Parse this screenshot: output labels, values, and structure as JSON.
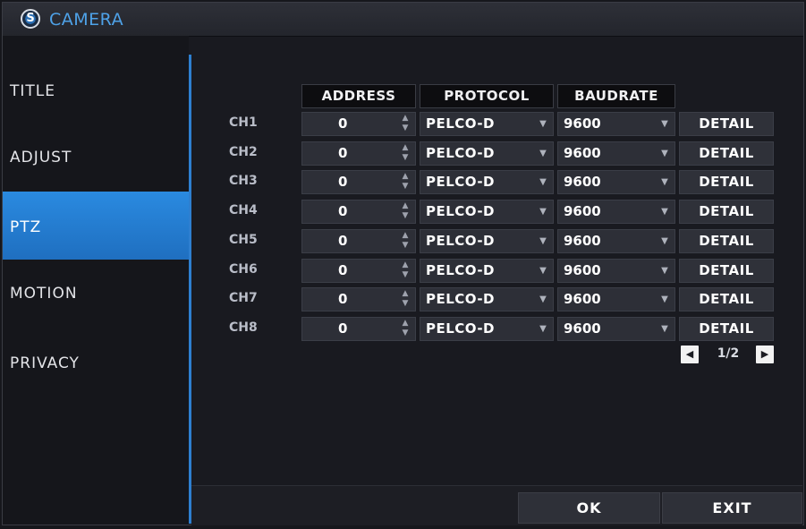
{
  "title": "CAMERA",
  "title_icon": "camera-logo-icon",
  "accent_color": "#2a8ae0",
  "sidebar": {
    "items": [
      {
        "label": "TITLE",
        "active": false
      },
      {
        "label": "ADJUST",
        "active": false
      },
      {
        "label": "PTZ",
        "active": true
      },
      {
        "label": "MOTION",
        "active": false
      },
      {
        "label": "PRIVACY",
        "active": false
      }
    ]
  },
  "columns": {
    "address": "ADDRESS",
    "protocol": "PROTOCOL",
    "baudrate": "BAUDRATE"
  },
  "rows": [
    {
      "channel": "CH1",
      "address": "0",
      "protocol": "PELCO-D",
      "baudrate": "9600",
      "detail": "DETAIL"
    },
    {
      "channel": "CH2",
      "address": "0",
      "protocol": "PELCO-D",
      "baudrate": "9600",
      "detail": "DETAIL"
    },
    {
      "channel": "CH3",
      "address": "0",
      "protocol": "PELCO-D",
      "baudrate": "9600",
      "detail": "DETAIL"
    },
    {
      "channel": "CH4",
      "address": "0",
      "protocol": "PELCO-D",
      "baudrate": "9600",
      "detail": "DETAIL"
    },
    {
      "channel": "CH5",
      "address": "0",
      "protocol": "PELCO-D",
      "baudrate": "9600",
      "detail": "DETAIL"
    },
    {
      "channel": "CH6",
      "address": "0",
      "protocol": "PELCO-D",
      "baudrate": "9600",
      "detail": "DETAIL"
    },
    {
      "channel": "CH7",
      "address": "0",
      "protocol": "PELCO-D",
      "baudrate": "9600",
      "detail": "DETAIL"
    },
    {
      "channel": "CH8",
      "address": "0",
      "protocol": "PELCO-D",
      "baudrate": "9600",
      "detail": "DETAIL"
    }
  ],
  "pager": {
    "text": "1/2",
    "prev_icon": "triangle-left-icon",
    "next_icon": "triangle-right-icon"
  },
  "footer": {
    "ok_label": "OK",
    "exit_label": "EXIT"
  }
}
